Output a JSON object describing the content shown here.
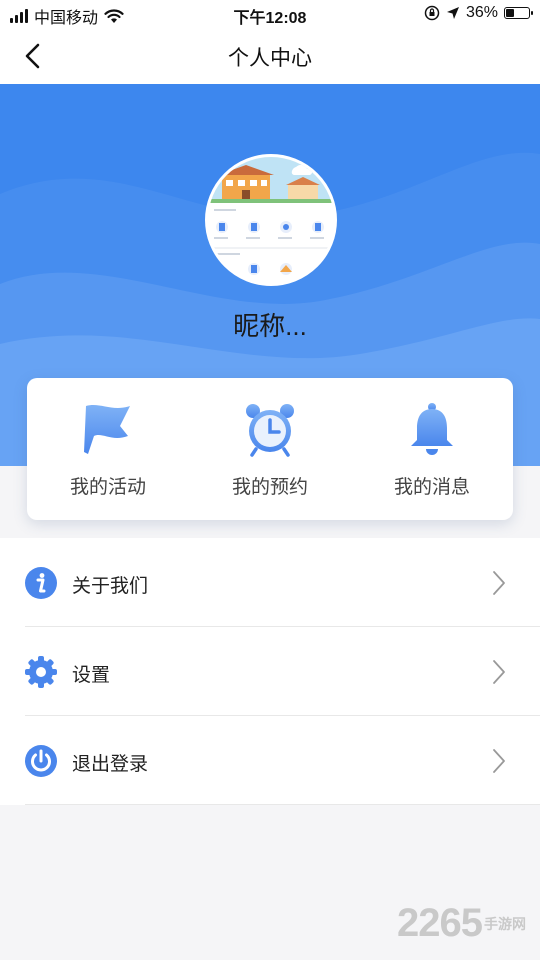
{
  "status_bar": {
    "carrier": "中国移动",
    "time": "下午12:08",
    "battery_text": "36%",
    "battery_level": 0.36,
    "icons": [
      "signal-icon",
      "wifi-icon",
      "orientation-lock-icon",
      "location-icon",
      "battery-icon"
    ]
  },
  "nav": {
    "title": "个人中心",
    "back_icon": "chevron-left-icon"
  },
  "profile": {
    "nickname": "昵称..."
  },
  "quick_actions": [
    {
      "label": "我的活动",
      "icon": "flag-icon"
    },
    {
      "label": "我的预约",
      "icon": "alarm-clock-icon"
    },
    {
      "label": "我的消息",
      "icon": "bell-icon"
    }
  ],
  "menu": [
    {
      "label": "关于我们",
      "icon": "info-icon"
    },
    {
      "label": "设置",
      "icon": "gear-icon"
    },
    {
      "label": "退出登录",
      "icon": "power-icon"
    }
  ],
  "watermark": {
    "number": "2265",
    "text": "手游网"
  },
  "colors": {
    "accent": "#4a86ec",
    "hero_bg": "#3d87ee",
    "page_bg": "#f5f5f7"
  }
}
